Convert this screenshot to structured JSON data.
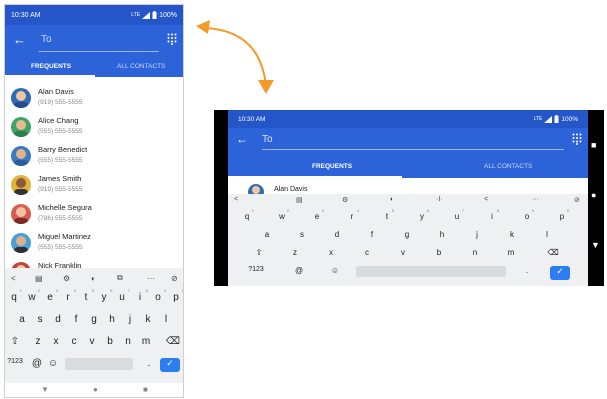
{
  "portrait": {
    "status": {
      "time": "10:30 AM",
      "network": "LTE",
      "battery": "100%"
    },
    "appbar": {
      "back": "←",
      "placeholder": "To",
      "dial_icon": "dialpad-icon"
    },
    "tabs": [
      "FREQUENTS",
      "ALL CONTACTS"
    ],
    "contacts": [
      {
        "name": "Alan Davis",
        "phone": "(919) 555-5555",
        "color": "#2f6bb7"
      },
      {
        "name": "Alice Chang",
        "phone": "(555) 555-5555",
        "color": "#3fa36a"
      },
      {
        "name": "Barry Benedict",
        "phone": "(555) 555-5555",
        "color": "#3a7ac2"
      },
      {
        "name": "James Smith",
        "phone": "(919) 555-5555",
        "color": "#e0b33b"
      },
      {
        "name": "Michelle Segura",
        "phone": "(786) 555-5555",
        "color": "#d95d4f"
      },
      {
        "name": "Miguel Martinez",
        "phone": "(555) 555-5555",
        "color": "#4a9fd6"
      },
      {
        "name": "Nick Franklin",
        "phone": "",
        "color": "#c0473f"
      }
    ],
    "keyboard": {
      "suggestions": [
        "<",
        "▤",
        "⚙",
        "◐",
        "⧉",
        "···",
        "⊘"
      ],
      "row1": [
        "q",
        "w",
        "e",
        "r",
        "t",
        "y",
        "u",
        "i",
        "o",
        "p"
      ],
      "row1_nums": [
        "1",
        "2",
        "3",
        "4",
        "5",
        "6",
        "7",
        "8",
        "9",
        "0"
      ],
      "row2": [
        "a",
        "s",
        "d",
        "f",
        "g",
        "h",
        "j",
        "k",
        "l"
      ],
      "row3": [
        "⇧",
        "z",
        "x",
        "c",
        "v",
        "b",
        "n",
        "m",
        "⌫"
      ],
      "row4": [
        "?123",
        "@",
        "☺",
        ",",
        ".",
        "✓"
      ]
    },
    "nav": [
      "▼",
      "●",
      "■"
    ]
  },
  "landscape": {
    "status": {
      "time": "10:30 AM",
      "network": "LTE",
      "battery": "100%"
    },
    "appbar": {
      "back": "←",
      "text": "To"
    },
    "tabs": [
      "FREQUENTS",
      "ALL CONTACTS"
    ],
    "contact": {
      "name": "Alan Davis"
    },
    "keyboard": {
      "suggestions": [
        "<",
        "▤",
        "⚙",
        "◐",
        "·I·",
        "<",
        "···",
        "⊘"
      ],
      "row1": [
        "q",
        "w",
        "e",
        "r",
        "t",
        "y",
        "u",
        "i",
        "o",
        "p"
      ],
      "row1_nums": [
        "1",
        "2",
        "3",
        "4",
        "5",
        "6",
        "7",
        "8",
        "9",
        "0"
      ],
      "row2": [
        "a",
        "s",
        "d",
        "f",
        "g",
        "h",
        "j",
        "k",
        "l"
      ],
      "row3": [
        "⇧",
        "z",
        "x",
        "c",
        "v",
        "b",
        "n",
        "m",
        "⌫"
      ],
      "row4": [
        "?123",
        "@",
        "☺",
        ",",
        ".",
        "✓"
      ]
    },
    "side_nav": [
      "■",
      "●",
      "▼"
    ]
  },
  "accent": "#2d63d8",
  "arrow_color": "#f39a2b"
}
